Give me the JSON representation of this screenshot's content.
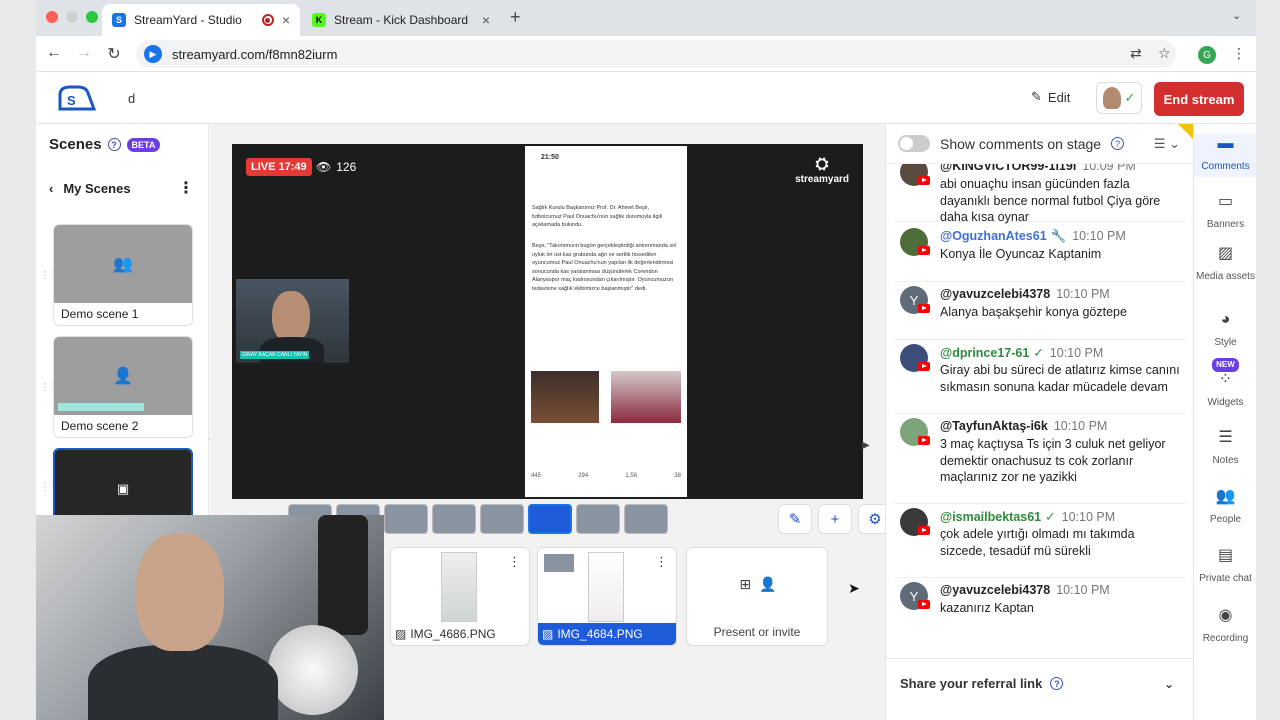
{
  "browser": {
    "tabs": [
      {
        "title": "StreamYard - Studio",
        "active": true
      },
      {
        "title": "Stream - Kick Dashboard",
        "active": false
      }
    ],
    "url": "streamyard.com/f8mn82iurm",
    "profile_initial": "G"
  },
  "header": {
    "title": "d",
    "edit_label": "Edit",
    "end_stream_label": "End stream"
  },
  "scenes": {
    "title": "Scenes",
    "beta_label": "BETA",
    "my_scenes_label": "My Scenes",
    "items": [
      {
        "label": "Demo scene 1"
      },
      {
        "label": "Demo scene 2"
      },
      {
        "label": ""
      }
    ]
  },
  "stage": {
    "live_label": "LIVE 17:49",
    "viewer_count": "126",
    "brand_label": "streamyard",
    "cam_tag": "GIRAY KAÇAR CANLI YAYIN",
    "phone_time": "21:50",
    "phone_text_1": "Sağlık Kurulu Başkanımız Prof. Dr. Ahmet Beşir, futbolcumuz Paul Onuachu'nun sağlık durumuyla ilgili açıklamada bulundu.",
    "phone_text_2": "Beşir, \"Takımımızın bugün gerçekleştirdiği antrenmanda sol uyluk ön üst kas grubunda ağrı ve sertlik hissedilen oyuncumuz Paul Onuachu'nun yapılan ilk değerlendirmesi sonucunda kas yaralanması düşünülerek Corendon Alanyaspor maç kadrosundan çıkarılmıştır. Oyuncumuzun tedavisine sağlık ekibimizce başlanmıştır\" dedi.",
    "phone_stats": [
      "445",
      "294",
      "1,58",
      "38"
    ]
  },
  "assets": {
    "items": [
      {
        "name": "IMG_4686.PNG",
        "selected": false
      },
      {
        "name": "IMG_4684.PNG",
        "selected": true
      }
    ],
    "present_label": "Present or invite"
  },
  "chat": {
    "show_on_stage_label": "Show comments on stage",
    "comments": [
      {
        "user": "@KINGVICTOR99-1l19l",
        "time": "10:09 PM",
        "message": "abi onuaçhu insan gücünden fazla dayanıklı bence normal futbol Çiya göre daha kısa oynar",
        "avatar": ""
      },
      {
        "user": "@OguzhanAtes61",
        "time": "10:10 PM",
        "message": "Konya İle Oyuncaz Kaptanim",
        "avatar": ""
      },
      {
        "user": "@yavuzcelebi4378",
        "time": "10:10 PM",
        "message": "Alanya başakşehir konya göztepe",
        "avatar": "Y"
      },
      {
        "user": "@dprince17-61",
        "time": "10:10 PM",
        "message": "Giray abi bu süreci de atlatırız kimse canını sıkmasın sonuna kadar mücadele devam",
        "avatar": ""
      },
      {
        "user": "@TayfunAktaş-i6k",
        "time": "10:10 PM",
        "message": "3 maç kaçtıysa Ts için 3 culuk net geliyor demektir onachusuz ts cok zorlanır maçlarınız zor ne yazikki",
        "avatar": ""
      },
      {
        "user": "@ismailbektas61",
        "time": "10:10 PM",
        "message": "çok adele yırtığı olmadı mı takımda sizcede, tesadüf mü sürekli",
        "avatar": ""
      },
      {
        "user": "@yavuzcelebi4378",
        "time": "10:10 PM",
        "message": "kazanırız Kaptan",
        "avatar": "Y"
      }
    ],
    "referral_label": "Share your referral link"
  },
  "rail": {
    "items": [
      {
        "label": "Comments",
        "icon": "comments-icon"
      },
      {
        "label": "Banners",
        "icon": "banners-icon"
      },
      {
        "label": "Media assets",
        "icon": "media-icon"
      },
      {
        "label": "Style",
        "icon": "palette-icon"
      },
      {
        "label": "Widgets",
        "icon": "widgets-icon"
      },
      {
        "label": "Notes",
        "icon": "notes-icon"
      },
      {
        "label": "People",
        "icon": "people-icon"
      },
      {
        "label": "Private chat",
        "icon": "private-chat-icon"
      },
      {
        "label": "Recording",
        "icon": "recording-icon"
      }
    ],
    "new_badge": "NEW"
  },
  "colors": {
    "brand_blue": "#1a56c4",
    "end_red": "#d32f2f",
    "live_red": "#e53935",
    "beta_purple": "#6a3de8"
  }
}
